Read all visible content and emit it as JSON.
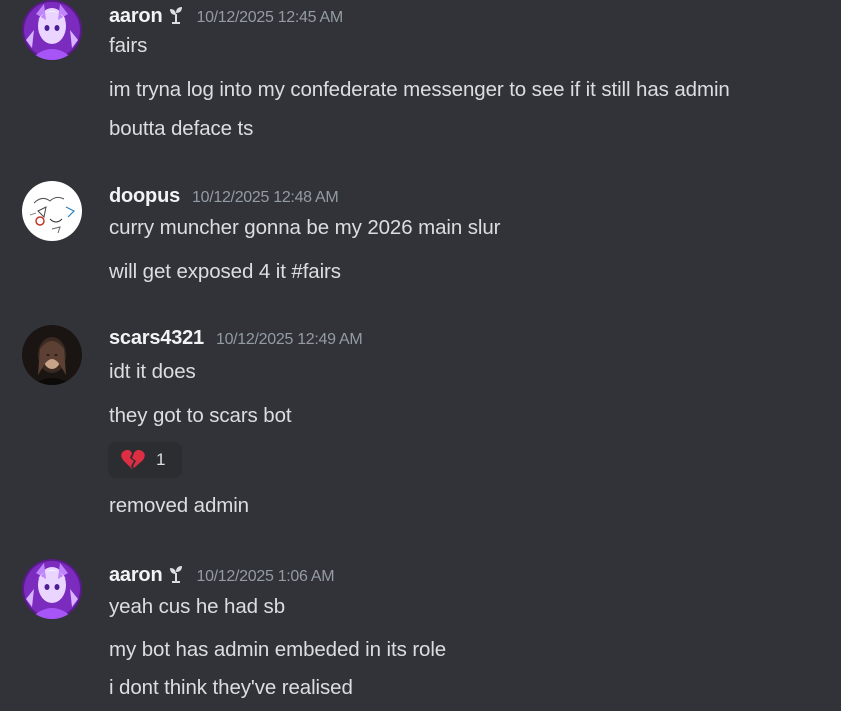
{
  "messages": [
    {
      "username": "aaron",
      "role_icon": "sprout-icon",
      "timestamp": "10/12/2025 12:45 AM",
      "lines": [
        "fairs",
        "im tryna log into my confederate messenger to see if it still has admin",
        "boutta deface ts"
      ]
    },
    {
      "username": "doopus",
      "timestamp": "10/12/2025 12:48 AM",
      "lines": [
        "curry muncher gonna be my 2026 main slur",
        "will get exposed 4 it #fairs"
      ]
    },
    {
      "username": "scars4321",
      "timestamp": "10/12/2025 12:49 AM",
      "lines": [
        "idt it does",
        "they got to scars bot",
        "removed admin"
      ],
      "reaction": {
        "emoji": "broken-heart-icon",
        "count": "1"
      }
    },
    {
      "username": "aaron",
      "role_icon": "sprout-icon",
      "timestamp": "10/12/2025 1:06 AM",
      "lines": [
        "yeah cus he had sb",
        "my bot has admin embeded in its role",
        "i dont think they've realised"
      ]
    }
  ],
  "colors": {
    "background": "#313338",
    "username": "#f2f3f5",
    "text": "#dbdee1",
    "timestamp": "#949ba4",
    "reaction_bg": "#2b2d31",
    "reaction_emoji": "#dd2e44"
  }
}
